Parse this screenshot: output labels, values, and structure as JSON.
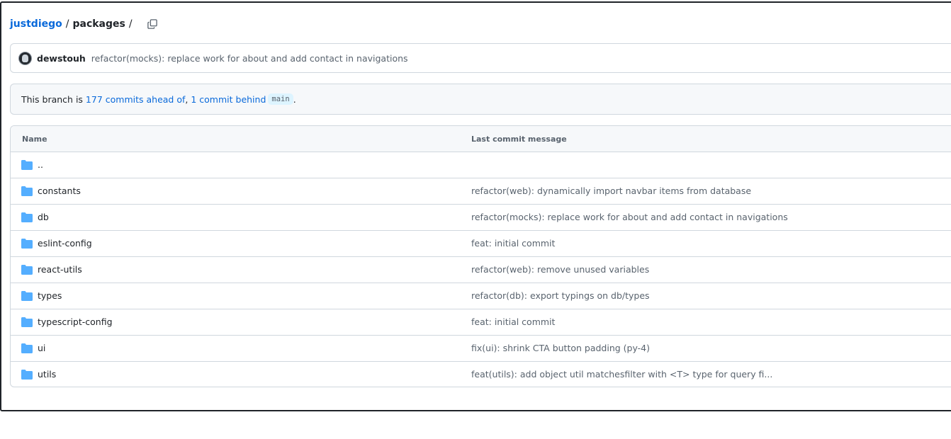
{
  "breadcrumb": {
    "owner": "justdiego",
    "sep1": "/",
    "current": "packages",
    "sep2": "/"
  },
  "latest_commit": {
    "author": "dewstouh",
    "message": "refactor(mocks): replace work for about and add contact in navigations"
  },
  "branch_status": {
    "prefix": "This branch is",
    "ahead": "177 commits ahead of",
    "comma": ",",
    "behind": "1 commit behind",
    "base": "main",
    "suffix": "."
  },
  "table": {
    "headers": {
      "name": "Name",
      "message": "Last commit message"
    },
    "rows": [
      {
        "name": "..",
        "message": ""
      },
      {
        "name": "constants",
        "message": "refactor(web): dynamically import navbar items from database"
      },
      {
        "name": "db",
        "message": "refactor(mocks): replace work for about and add contact in navigations"
      },
      {
        "name": "eslint-config",
        "message": "feat: initial commit"
      },
      {
        "name": "react-utils",
        "message": "refactor(web): remove unused variables"
      },
      {
        "name": "types",
        "message": "refactor(db): export typings on db/types"
      },
      {
        "name": "typescript-config",
        "message": "feat: initial commit"
      },
      {
        "name": "ui",
        "message": "fix(ui): shrink CTA button padding (py-4)"
      },
      {
        "name": "utils",
        "message": "feat(utils): add object util matchesfilter with <T> type for query fi..."
      }
    ]
  },
  "icons": {
    "folder": "folder-icon",
    "copy": "copy-icon",
    "avatar": "avatar"
  },
  "colors": {
    "link": "#0969da",
    "folder": "#54aeff",
    "muted": "#59636e",
    "border": "#d0d7de"
  }
}
